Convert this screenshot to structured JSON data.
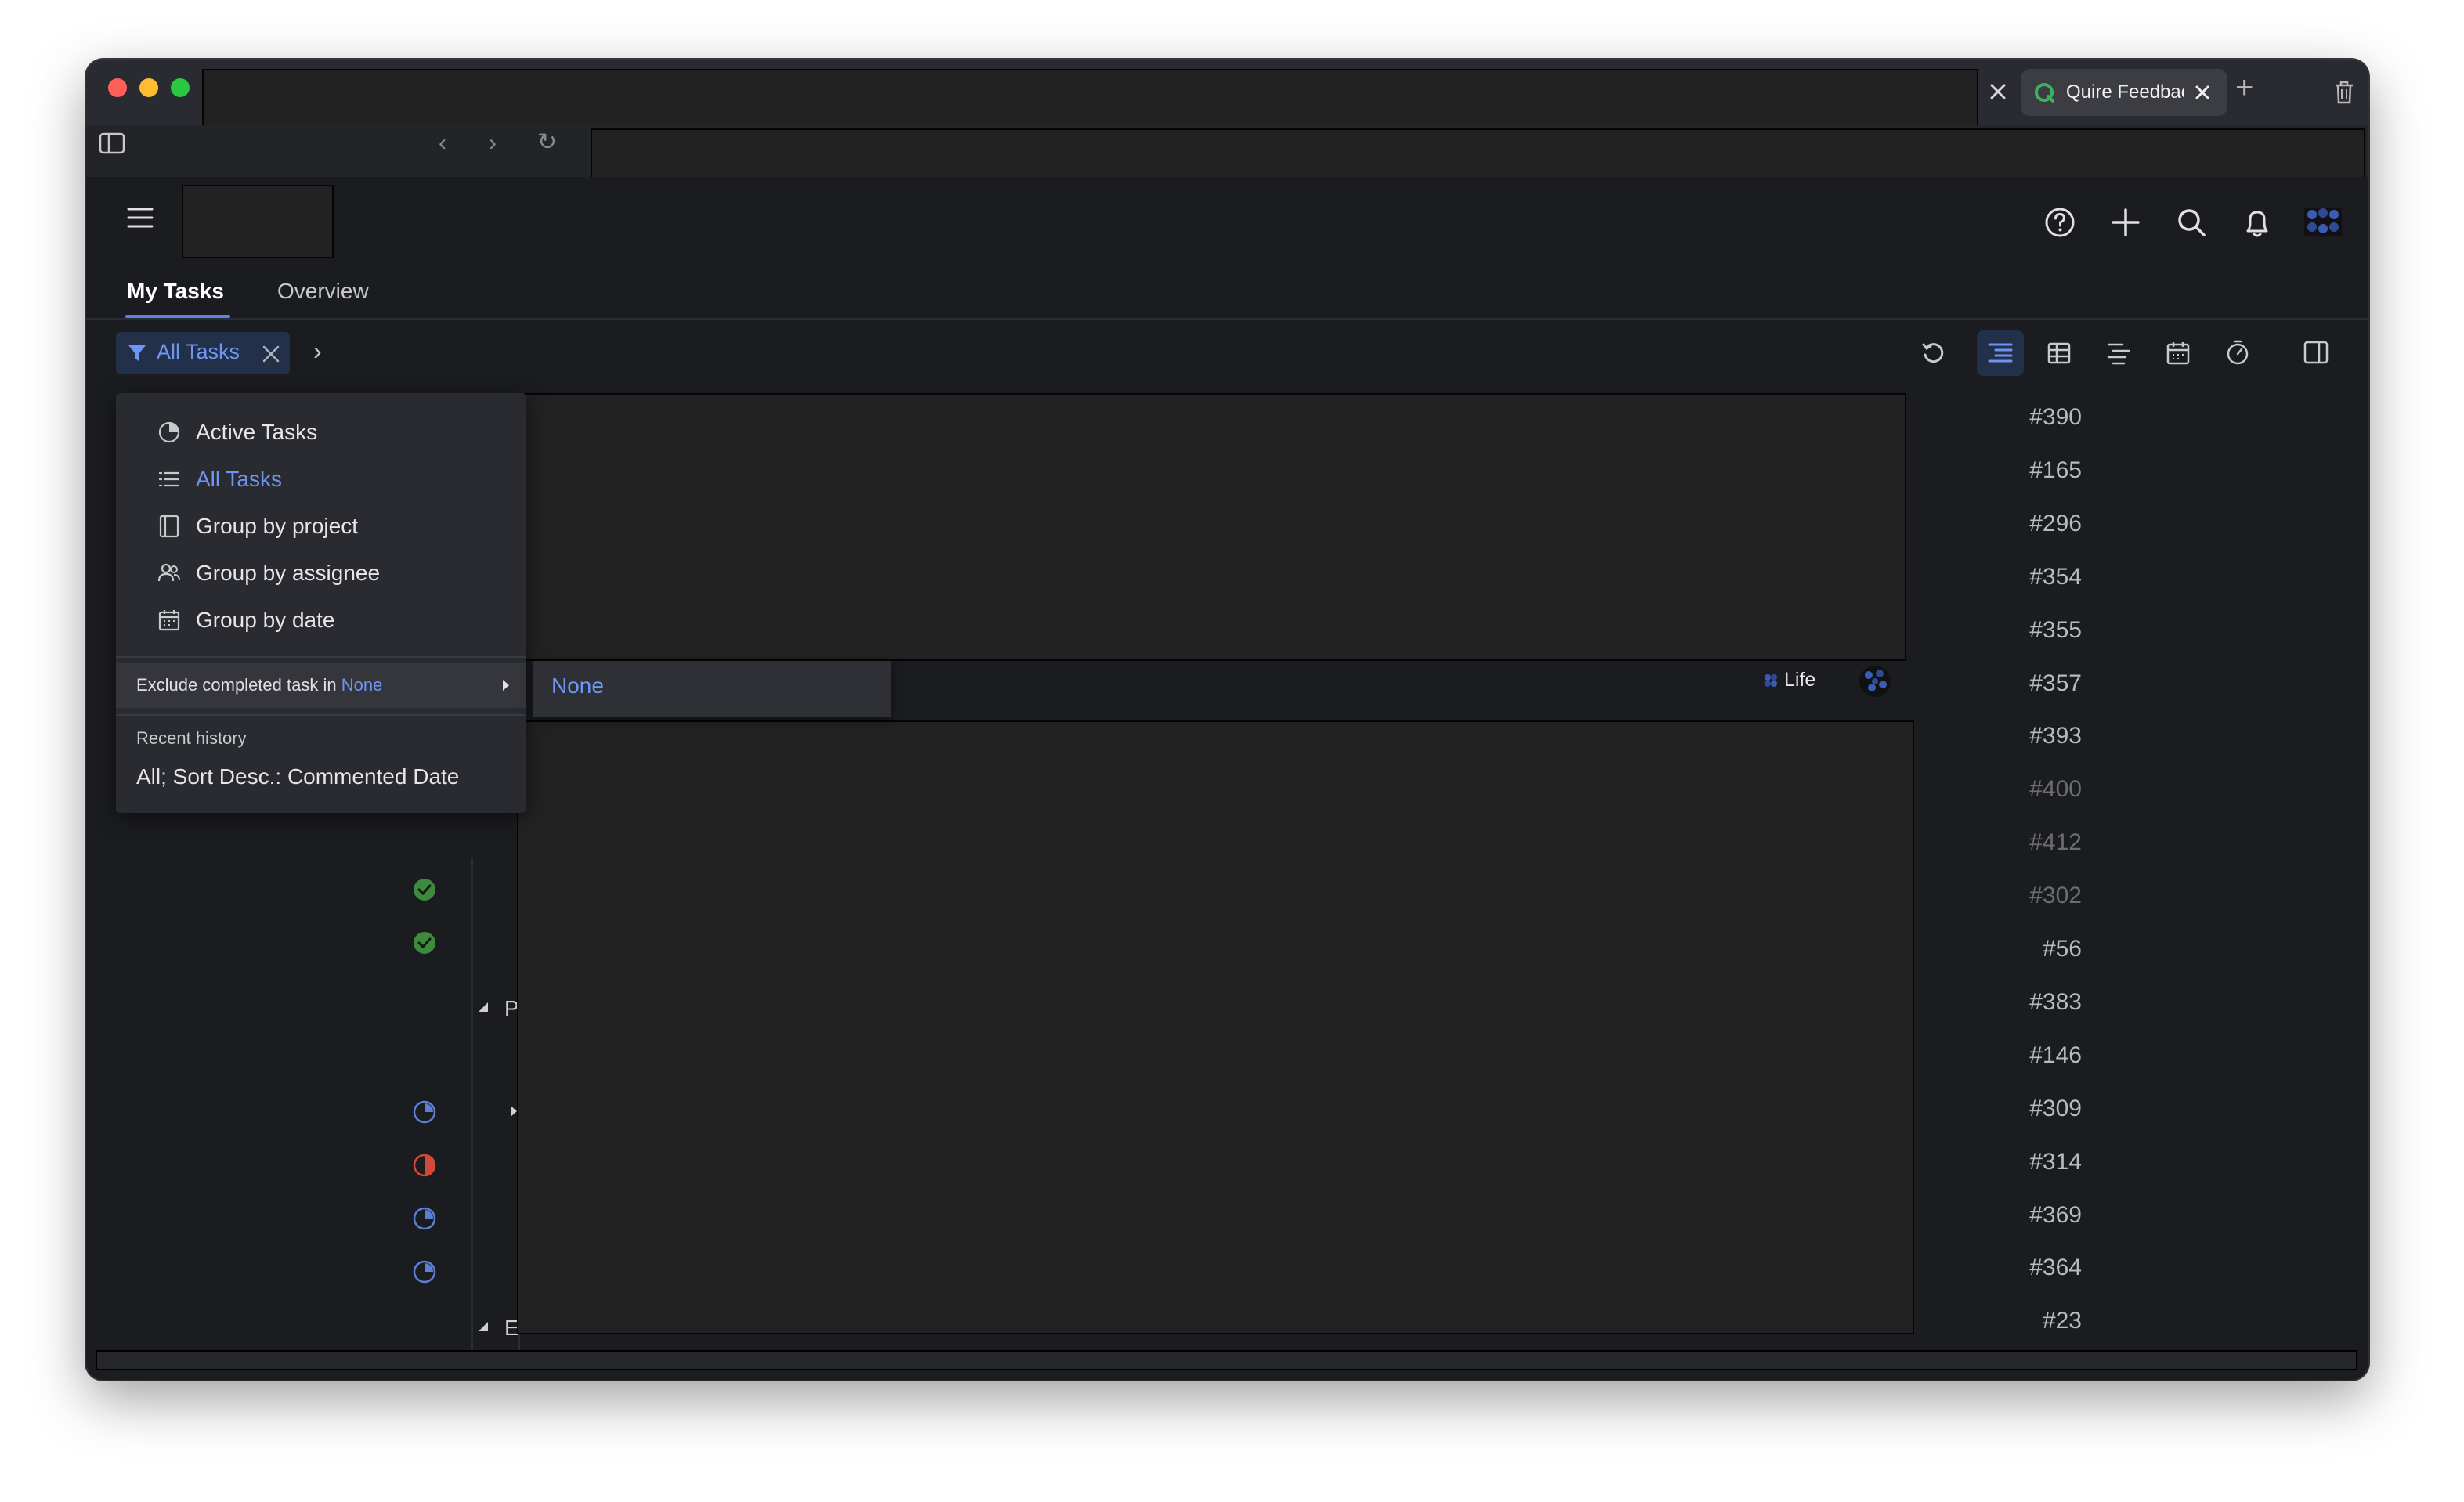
{
  "browser": {
    "active_tab_title": "Quire Feedback",
    "new_tab_symbol": "+"
  },
  "app": {
    "tabs": [
      {
        "label": "My Tasks",
        "active": true
      },
      {
        "label": "Overview",
        "active": false
      }
    ],
    "filter_chip_label": "All Tasks",
    "accent_color": "#6f95f2"
  },
  "filter_menu": {
    "items": [
      {
        "icon": "pie-chart-icon",
        "label": "Active Tasks",
        "selected": false
      },
      {
        "icon": "list-icon",
        "label": "All Tasks",
        "selected": true
      },
      {
        "icon": "project-icon",
        "label": "Group by project",
        "selected": false
      },
      {
        "icon": "people-icon",
        "label": "Group by assignee",
        "selected": false
      },
      {
        "icon": "calendar-icon",
        "label": "Group by date",
        "selected": false
      }
    ],
    "exclude_prefix": "Exclude completed task in",
    "exclude_value": "None",
    "recent_history_heading": "Recent history",
    "recent_history_item": "All; Sort Desc.: Commented Date"
  },
  "submenu": {
    "option": "None"
  },
  "visible_row": {
    "tag": "Life"
  },
  "row_letters": [
    "P",
    "E"
  ],
  "task_ids": [
    {
      "id": "#390",
      "dim": false
    },
    {
      "id": "#165",
      "dim": false
    },
    {
      "id": "#296",
      "dim": false
    },
    {
      "id": "#354",
      "dim": false
    },
    {
      "id": "#355",
      "dim": false
    },
    {
      "id": "#357",
      "dim": false
    },
    {
      "id": "#393",
      "dim": false
    },
    {
      "id": "#400",
      "dim": true
    },
    {
      "id": "#412",
      "dim": true
    },
    {
      "id": "#302",
      "dim": true
    },
    {
      "id": "#56",
      "dim": false
    },
    {
      "id": "#383",
      "dim": false
    },
    {
      "id": "#146",
      "dim": false
    },
    {
      "id": "#309",
      "dim": false
    },
    {
      "id": "#314",
      "dim": false
    },
    {
      "id": "#369",
      "dim": false
    },
    {
      "id": "#364",
      "dim": false
    },
    {
      "id": "#23",
      "dim": false
    }
  ],
  "status_icons": [
    {
      "type": "done-icon",
      "color": "#3d8a3d"
    },
    {
      "type": "done-icon",
      "color": "#3d8a3d"
    },
    {
      "type": "in-progress-icon",
      "color": "#5c7fd4"
    },
    {
      "type": "overdue-icon",
      "color": "#d04a3a"
    },
    {
      "type": "in-progress-icon",
      "color": "#5c7fd4"
    },
    {
      "type": "in-progress-icon",
      "color": "#5c7fd4"
    }
  ]
}
